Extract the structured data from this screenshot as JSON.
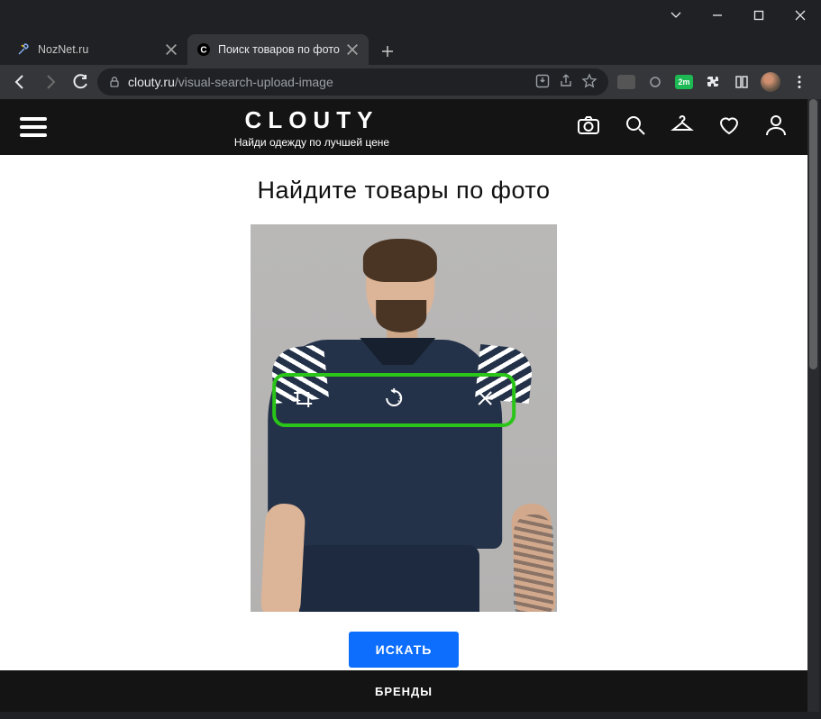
{
  "window": {
    "tabs": [
      {
        "title": "NozNet.ru",
        "favicon": "noznet"
      },
      {
        "title": "Поиск товаров по фото",
        "favicon": "clouty"
      }
    ],
    "url_domain": "clouty.ru",
    "url_path": "/visual-search-upload-image",
    "ext_badge_text": "2m"
  },
  "header": {
    "logo": "CLOUTY",
    "tagline": "Найди одежду по лучшей цене"
  },
  "main": {
    "heading": "Найдите товары по фото",
    "search_button": "ИСКАТЬ"
  },
  "image_toolbar": {
    "crop": "crop",
    "rotate": "rotate",
    "remove": "remove"
  },
  "footer": {
    "brands_label": "БРЕНДЫ"
  }
}
